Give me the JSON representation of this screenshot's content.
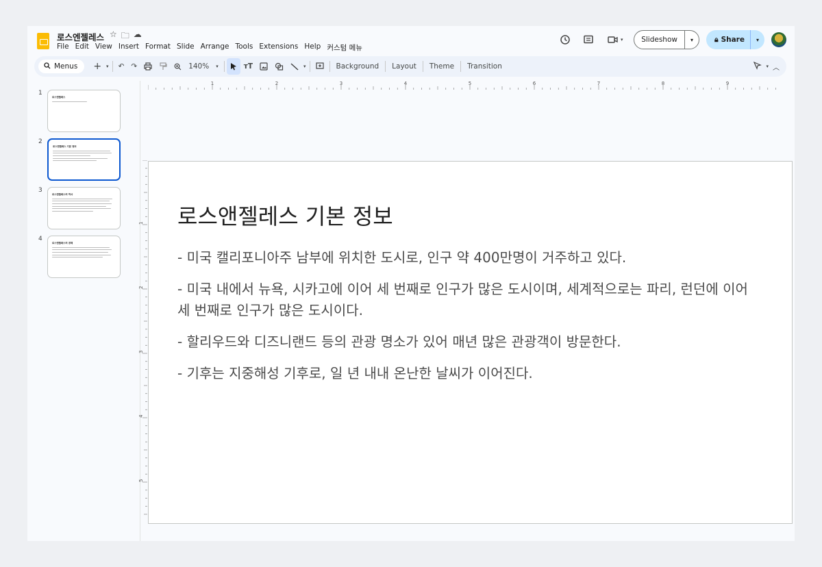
{
  "app": {
    "doc_title": "로스엔젤레스",
    "menu": [
      "File",
      "Edit",
      "View",
      "Insert",
      "Format",
      "Slide",
      "Arrange",
      "Tools",
      "Extensions",
      "Help",
      "커스텀 메뉴"
    ],
    "slideshow_label": "Slideshow",
    "share_label": "Share"
  },
  "toolbar": {
    "menus_label": "Menus",
    "zoom": "140%",
    "background_label": "Background",
    "layout_label": "Layout",
    "theme_label": "Theme",
    "transition_label": "Transition"
  },
  "ruler": {
    "h_ticks": [
      "1",
      "2",
      "3",
      "4",
      "5",
      "6",
      "7",
      "8",
      "9"
    ],
    "v_ticks": [
      "1",
      "2",
      "3",
      "4",
      "5"
    ]
  },
  "filmstrip": [
    {
      "num": "1",
      "title": "로스엔젤레스"
    },
    {
      "num": "2",
      "title": "로스앤젤레스 기본 정보"
    },
    {
      "num": "3",
      "title": "로스앤젤레스의 역사"
    },
    {
      "num": "4",
      "title": "로스앤젤레스의 경제"
    }
  ],
  "slide": {
    "title": "로스앤젤레스 기본 정보",
    "bullets": [
      "- 미국 캘리포니아주 남부에 위치한 도시로, 인구 약 400만명이 거주하고 있다.",
      "- 미국 내에서 뉴욕, 시카고에 이어 세 번째로 인구가 많은 도시이며, 세계적으로는 파리, 런던에 이어 세 번째로 인구가 많은 도시이다.",
      "- 할리우드와 디즈니랜드 등의 관광 명소가 있어 매년 많은 관광객이 방문한다.",
      "- 기후는 지중해성 기후로, 일 년 내내 온난한 날씨가 이어진다."
    ]
  },
  "colors": {
    "accent": "#0b57d0",
    "share_bg": "#c2e7ff",
    "doc_icon": "#fbbc04"
  }
}
